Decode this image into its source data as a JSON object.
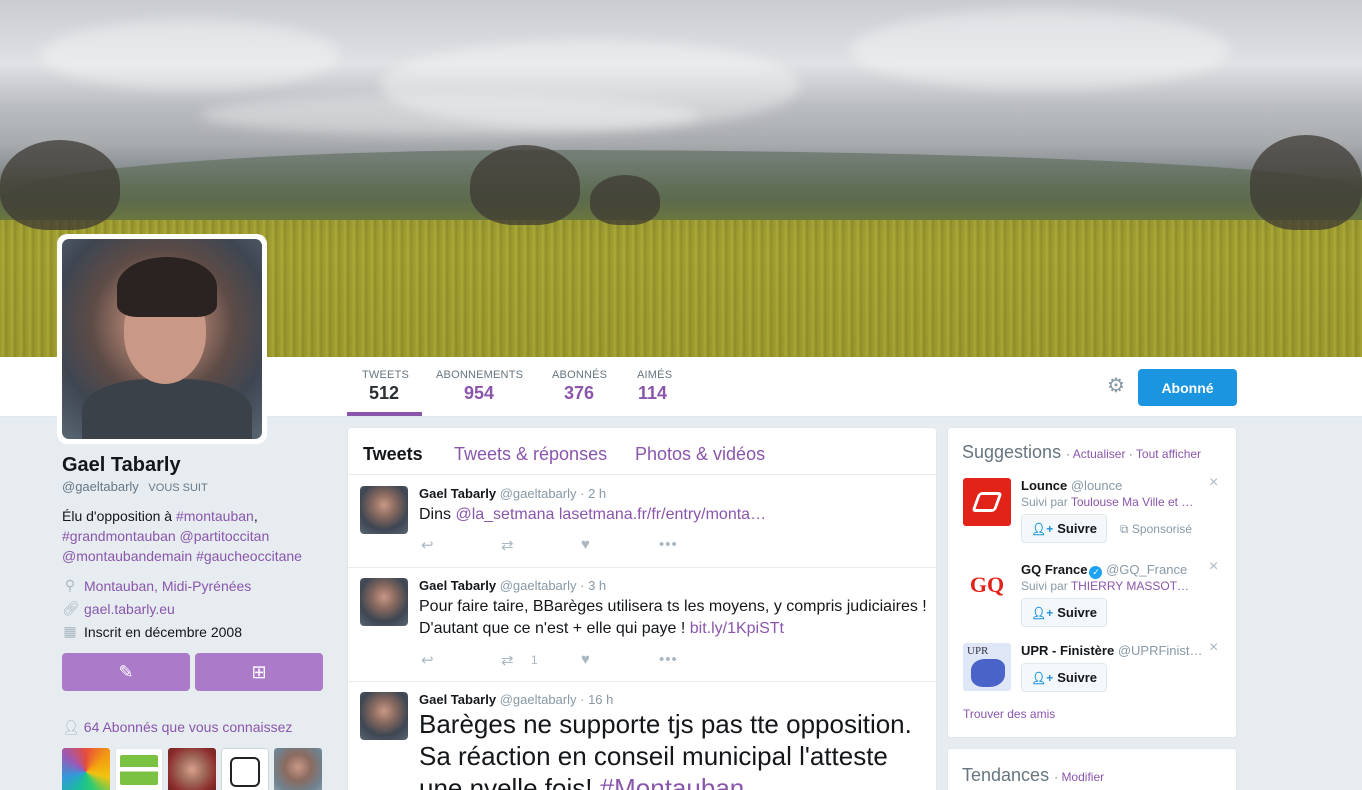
{
  "profile": {
    "name": "Gael Tabarly",
    "handle": "@gaeltabarly",
    "follows_you": "VOUS SUIT",
    "bio_parts": [
      {
        "text": "Élu d'opposition à ",
        "link": false
      },
      {
        "text": "#montauban",
        "link": true
      },
      {
        "text": ", ",
        "link": false
      },
      {
        "text": "#grandmontauban",
        "link": true
      },
      {
        "text": " ",
        "link": false
      },
      {
        "text": "@partitoccitan",
        "link": true
      },
      {
        "text": " ",
        "link": false
      },
      {
        "text": "@montaubandemain",
        "link": true
      },
      {
        "text": " ",
        "link": false
      },
      {
        "text": "#gaucheoccitane",
        "link": true
      }
    ],
    "location": "Montauban, Midi-Pyrénées",
    "website": "gael.tabarly.eu",
    "joined": "Inscrit en décembre 2008",
    "followers_known": "64 Abonnés que vous connaissez"
  },
  "stats": [
    {
      "label": "TWEETS",
      "value": "512"
    },
    {
      "label": "ABONNEMENTS",
      "value": "954"
    },
    {
      "label": "ABONNÉS",
      "value": "376"
    },
    {
      "label": "AIMÉS",
      "value": "114"
    }
  ],
  "follow_button": "Abonné",
  "timeline": {
    "tabs": [
      "Tweets",
      "Tweets & réponses",
      "Photos & vidéos"
    ],
    "tweets": [
      {
        "name": "Gael Tabarly",
        "handle": "@gaeltabarly",
        "time": "2 h",
        "parts": [
          {
            "text": "Dins ",
            "link": false
          },
          {
            "text": "@la_setmana",
            "link": true
          },
          {
            "text": " ",
            "link": false
          },
          {
            "text": "lasetmana.fr/fr/entry/monta…",
            "link": true
          }
        ],
        "retweets": ""
      },
      {
        "name": "Gael Tabarly",
        "handle": "@gaeltabarly",
        "time": "3 h",
        "parts": [
          {
            "text": "Pour faire taire, BBarèges utilisera ts les moyens, y compris judiciaires ! D'autant que ce n'est + elle qui paye ! ",
            "link": false
          },
          {
            "text": "bit.ly/1KpiSTt",
            "link": true
          }
        ],
        "retweets": "1"
      },
      {
        "name": "Gael Tabarly",
        "handle": "@gaeltabarly",
        "time": "16 h",
        "parts": [
          {
            "text": "Barèges ne supporte tjs pas tte opposition. Sa réaction en conseil municipal l'atteste une nvelle fois! ",
            "link": false
          },
          {
            "text": "#Montauban",
            "link": true
          }
        ],
        "retweets": ""
      }
    ]
  },
  "suggestions": {
    "title": "Suggestions",
    "refresh": "Actualiser",
    "view_all": "Tout afficher",
    "follow_label": "Suivre",
    "items": [
      {
        "name": "Lounce",
        "handle": "@lounce",
        "sub_prefix": "Suivi par ",
        "sub": "Toulouse Ma Ville et …",
        "promoted": "Sponsorisé",
        "verified": false,
        "avatar_color": "#e2231a"
      },
      {
        "name": "GQ France",
        "handle": "@GQ_France",
        "sub_prefix": "Suivi par ",
        "sub": "THIERRY MASSOT…",
        "promoted": "",
        "verified": true,
        "avatar_color": "#ffffff"
      },
      {
        "name": "UPR - Finistère",
        "handle": "@UPRFinist…",
        "sub_prefix": "",
        "sub": "",
        "promoted": "",
        "verified": false,
        "avatar_color": "#dfe6f5"
      }
    ],
    "find_friends": "Trouver des amis"
  },
  "trends": {
    "title": "Tendances",
    "modify": "Modifier"
  },
  "colors": {
    "accent": "#8a56ac",
    "button_blue": "#1b95e0",
    "action_purple": "#ab7bc9"
  },
  "icons": [
    "settings-gear-icon",
    "location-pin-icon",
    "link-icon",
    "calendar-icon",
    "compose-tweet-icon",
    "direct-message-icon",
    "people-icon",
    "reply-icon",
    "retweet-icon",
    "like-icon",
    "more-icon",
    "add-user-icon",
    "promoted-icon",
    "close-icon",
    "verified-icon"
  ]
}
